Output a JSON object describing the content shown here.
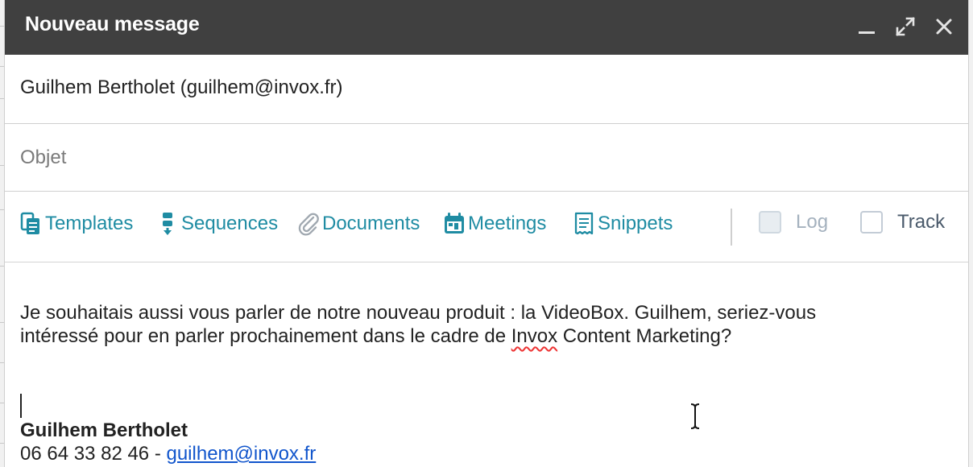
{
  "window": {
    "title": "Nouveau message",
    "controls": [
      "minimize-icon",
      "expand-icon",
      "close-icon"
    ]
  },
  "to": {
    "recipient": "Guilhem Bertholet (guilhem@invox.fr)"
  },
  "subject": {
    "placeholder": "Objet",
    "value": ""
  },
  "toolbar": {
    "items": [
      {
        "label": "Templates",
        "icon": "templates-icon"
      },
      {
        "label": "Sequences",
        "icon": "sequences-icon"
      },
      {
        "label": "Documents",
        "icon": "paperclip-icon"
      },
      {
        "label": "Meetings",
        "icon": "calendar-icon"
      },
      {
        "label": "Snippets",
        "icon": "snippet-icon"
      }
    ],
    "log_label": "Log",
    "log_checked": false,
    "track_label": "Track",
    "track_checked": false
  },
  "body": {
    "line1": "Je souhaitais aussi vous parler de notre nouveau produit : la VideoBox. Guilhem, seriez-vous",
    "line2_before": "intéressé pour en parler prochainement dans le cadre de ",
    "line2_misspelled": "Invox",
    "line2_after": " Content Marketing?"
  },
  "signature": {
    "name": "Guilhem Bertholet",
    "phone": "06 64 33 82 46 - ",
    "email": "guilhem@invox.fr"
  },
  "colors": {
    "titlebar": "#404040",
    "tool_link": "#1f8ca3",
    "link": "#1155cc",
    "log_text": "#a4b1be",
    "track_text": "#4a5a6b"
  }
}
